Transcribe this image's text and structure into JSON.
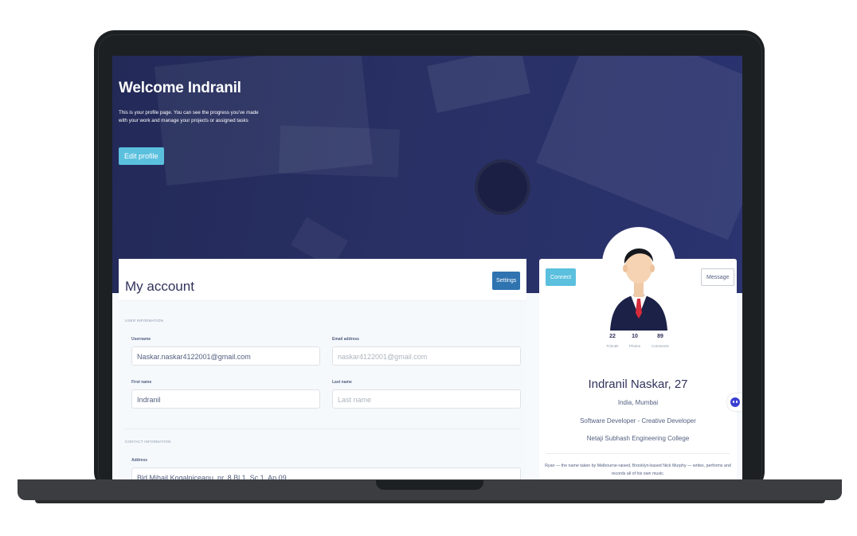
{
  "hero": {
    "title": "Welcome Indranil",
    "text": "This is your profile page. You can see the progress you've made with your work and manage your projects or assigned tasks",
    "edit_button": "Edit profile"
  },
  "account": {
    "title": "My account",
    "settings_button": "Settings",
    "user_section": "USER INFORMATION",
    "contact_section": "CONTACT INFORMATION",
    "username_label": "Username",
    "username_value": "Naskar.naskar4122001@gmail.com",
    "email_label": "Email address",
    "email_placeholder": "naskar4122001@gmail.com",
    "firstname_label": "First name",
    "firstname_value": "Indranil",
    "lastname_label": "Last name",
    "lastname_placeholder": "Last name",
    "address_label": "Address",
    "address_value": "Bld Mihail Kogalniceanu, nr. 8 Bl 1, Sc 1, Ap 09"
  },
  "profile": {
    "connect_button": "Connect",
    "message_button": "Message",
    "stats": [
      {
        "value": "22",
        "label": "Friends"
      },
      {
        "value": "10",
        "label": "Photos"
      },
      {
        "value": "89",
        "label": "Comments"
      }
    ],
    "name": "Indranil Naskar, 27",
    "location": "India, Mumbai",
    "role": "Software Developer - Creative Developer",
    "college": "Netaji Subhash Engineering College",
    "bio": "Ryan — the name taken by Melbourne-raised, Brooklyn-based Nick Murphy — writes, performs and records all of his own music."
  },
  "colors": {
    "hero_bg": "#283064",
    "accent_cyan": "#5bc0de",
    "settings_blue": "#2f73b0",
    "chat_icon": "#3b3fd1"
  }
}
